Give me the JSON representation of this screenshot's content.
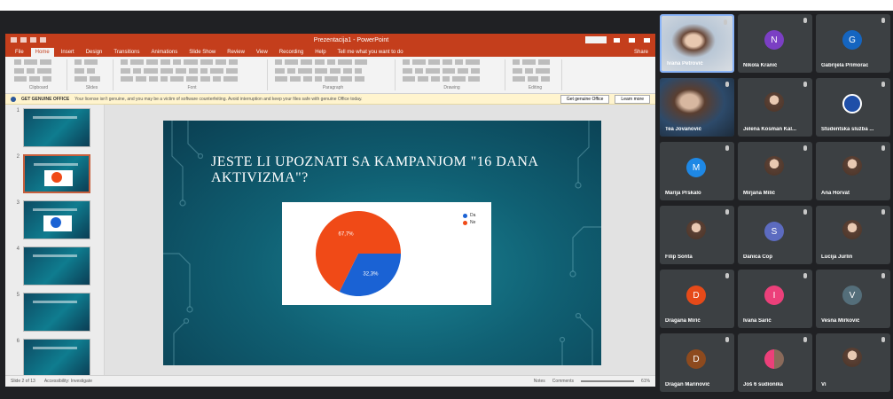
{
  "ppt": {
    "window_title": "Prezentacija1 - PowerPoint",
    "tabs": [
      "File",
      "Home",
      "Insert",
      "Design",
      "Transitions",
      "Animations",
      "Slide Show",
      "Review",
      "View",
      "Recording",
      "Help",
      "Tell me what you want to do"
    ],
    "active_tab": "Home",
    "share_label": "Share",
    "ribbon_groups": [
      "Clipboard",
      "Slides",
      "Font",
      "Paragraph",
      "Drawing",
      "Editing"
    ],
    "message_bar": {
      "head": "GET GENUINE OFFICE",
      "text": "Your license isn't genuine, and you may be a victim of software counterfeiting. Avoid interruption and keep your files safe with genuine Office today.",
      "btn1": "Get genuine Office",
      "btn2": "Learn more"
    },
    "slide_numbers": [
      "1",
      "2",
      "3",
      "4",
      "5",
      "6"
    ],
    "status": {
      "left": "Slide 2 of 13",
      "accessibility": "Accessibility: Investigate",
      "notes": "Notes",
      "comments": "Comments",
      "zoom": "61%"
    }
  },
  "slide": {
    "title": "JESTE LI UPOZNATI SA KAMPANJOM \"16 DANA AKTIVIZMA\"?"
  },
  "chart_data": {
    "type": "pie",
    "title": "",
    "series": [
      {
        "name": "Da",
        "value": 32.3,
        "label": "32,3%",
        "color": "#1a62d4"
      },
      {
        "name": "Ne",
        "value": 67.7,
        "label": "67,7%",
        "color": "#f04a17"
      }
    ],
    "legend_position": "top-right"
  },
  "participants": [
    {
      "name": "Ivana Petrović",
      "avatar_letter": "",
      "avatar_color": "",
      "type": "video"
    },
    {
      "name": "Nikola Kranić",
      "avatar_letter": "N",
      "avatar_color": "#7b3fc4",
      "type": "letter"
    },
    {
      "name": "Gabrijela Primorac",
      "avatar_letter": "G",
      "avatar_color": "#1565c0",
      "type": "letter"
    },
    {
      "name": "Tea Jovanović",
      "avatar_letter": "",
      "avatar_color": "",
      "type": "video"
    },
    {
      "name": "Jelena Kosman Kal...",
      "avatar_letter": "",
      "avatar_color": "",
      "type": "photo"
    },
    {
      "name": "Studentska služba ...",
      "avatar_letter": "",
      "avatar_color": "#1f4fa8",
      "type": "logo"
    },
    {
      "name": "Marija Prskalo",
      "avatar_letter": "M",
      "avatar_color": "#1e88e5",
      "type": "letter"
    },
    {
      "name": "Mirjana Milić",
      "avatar_letter": "",
      "avatar_color": "",
      "type": "photo"
    },
    {
      "name": "Ana Horvat",
      "avatar_letter": "",
      "avatar_color": "",
      "type": "photo"
    },
    {
      "name": "Filip Sonta",
      "avatar_letter": "",
      "avatar_color": "",
      "type": "photo"
    },
    {
      "name": "Danica Čop",
      "avatar_letter": "S",
      "avatar_color": "#5c6bc0",
      "type": "letter"
    },
    {
      "name": "Lucija Jurlin",
      "avatar_letter": "",
      "avatar_color": "",
      "type": "photo"
    },
    {
      "name": "Dragana Mirić",
      "avatar_letter": "D",
      "avatar_color": "#e64a19",
      "type": "letter"
    },
    {
      "name": "Ivana Šarić",
      "avatar_letter": "I",
      "avatar_color": "#ec407a",
      "type": "letter"
    },
    {
      "name": "Vesna Mirković",
      "avatar_letter": "V",
      "avatar_color": "#546e7a",
      "type": "letter"
    },
    {
      "name": "Dragan Marinović",
      "avatar_letter": "D",
      "avatar_color": "#8d4a1e",
      "type": "letter"
    },
    {
      "name": "Još 6 sudionika",
      "avatar_letter": "",
      "avatar_color": "",
      "type": "group"
    },
    {
      "name": "Vi",
      "avatar_letter": "",
      "avatar_color": "",
      "type": "photo"
    }
  ]
}
